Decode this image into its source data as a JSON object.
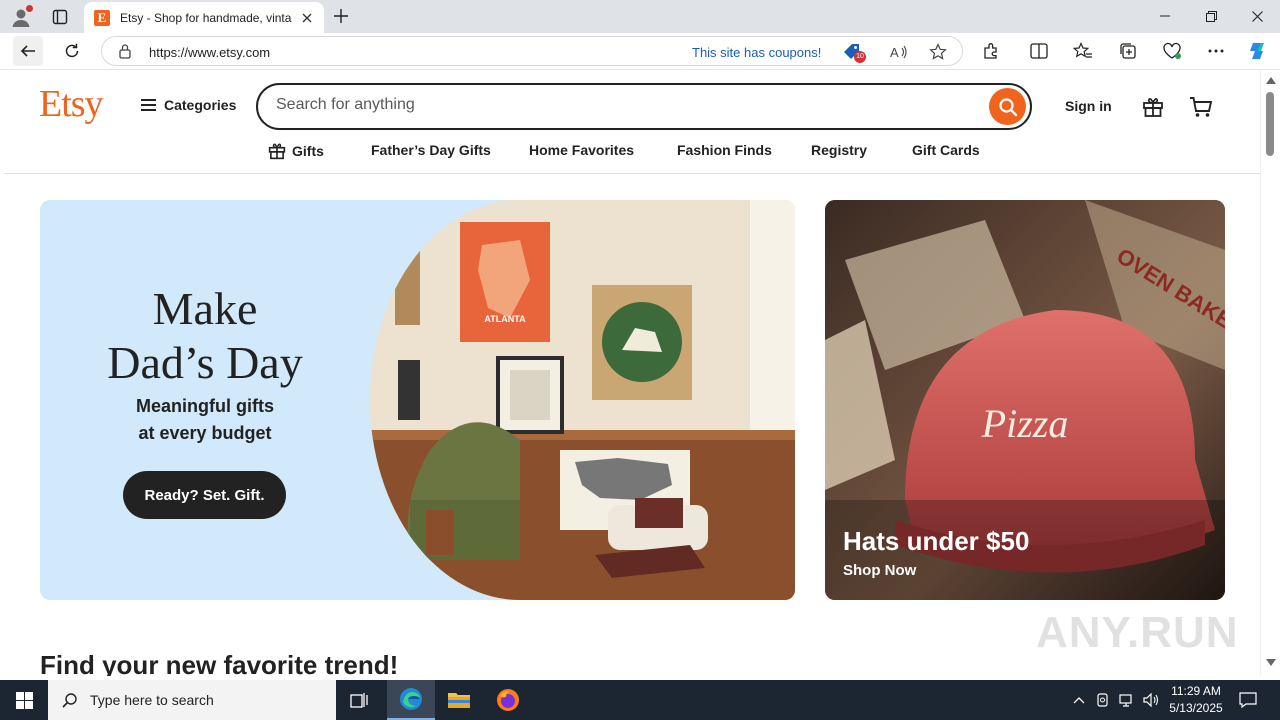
{
  "browser": {
    "tab_title": "Etsy - Shop for handmade, vintage",
    "favicon_letter": "E",
    "url": "https://www.etsy.com",
    "coupons_text": "This site has coupons!",
    "coupon_badge": "10",
    "accent_color": "#f1641e"
  },
  "etsy": {
    "logo": "Etsy",
    "categories_label": "Categories",
    "search_placeholder": "Search for anything",
    "signin_label": "Sign in",
    "nav": [
      "Gifts",
      "Father’s Day Gifts",
      "Home Favorites",
      "Fashion Finds",
      "Registry",
      "Gift Cards"
    ]
  },
  "hero": {
    "heading_line1": "Make",
    "heading_line2": "Dad’s Day",
    "sub_line1": "Meaningful gifts",
    "sub_line2": "at every budget",
    "cta": "Ready? Set. Gift.",
    "poster_text": "ATLANTA",
    "background_color": "#d1e9fa"
  },
  "promo": {
    "title": "Hats under $50",
    "link": "Shop Now",
    "hat_text": "Pizza",
    "box_text": "OVEN BAKED"
  },
  "section": {
    "trend_heading": "Find your new favorite trend!"
  },
  "watermark": "ANY.RUN",
  "taskbar": {
    "search_placeholder": "Type here to search",
    "time": "11:29 AM",
    "date": "5/13/2025"
  },
  "icons": [
    "profile-icon",
    "tabs-icon",
    "close-icon",
    "plus-icon",
    "minimize-icon",
    "restore-icon",
    "back-arrow-icon",
    "refresh-icon",
    "lock-icon",
    "coupon-icon",
    "read-aloud-icon",
    "star-icon",
    "extensions-icon",
    "split-screen-icon",
    "favorites-icon",
    "collections-icon",
    "performance-icon",
    "more-icon",
    "copilot-icon",
    "hamburger-icon",
    "search-icon",
    "gift-icon",
    "cart-icon",
    "windows-start-icon",
    "task-view-icon",
    "edge-icon",
    "file-explorer-icon",
    "firefox-icon",
    "chevron-up-icon",
    "network-icon",
    "volume-icon",
    "notification-icon"
  ]
}
